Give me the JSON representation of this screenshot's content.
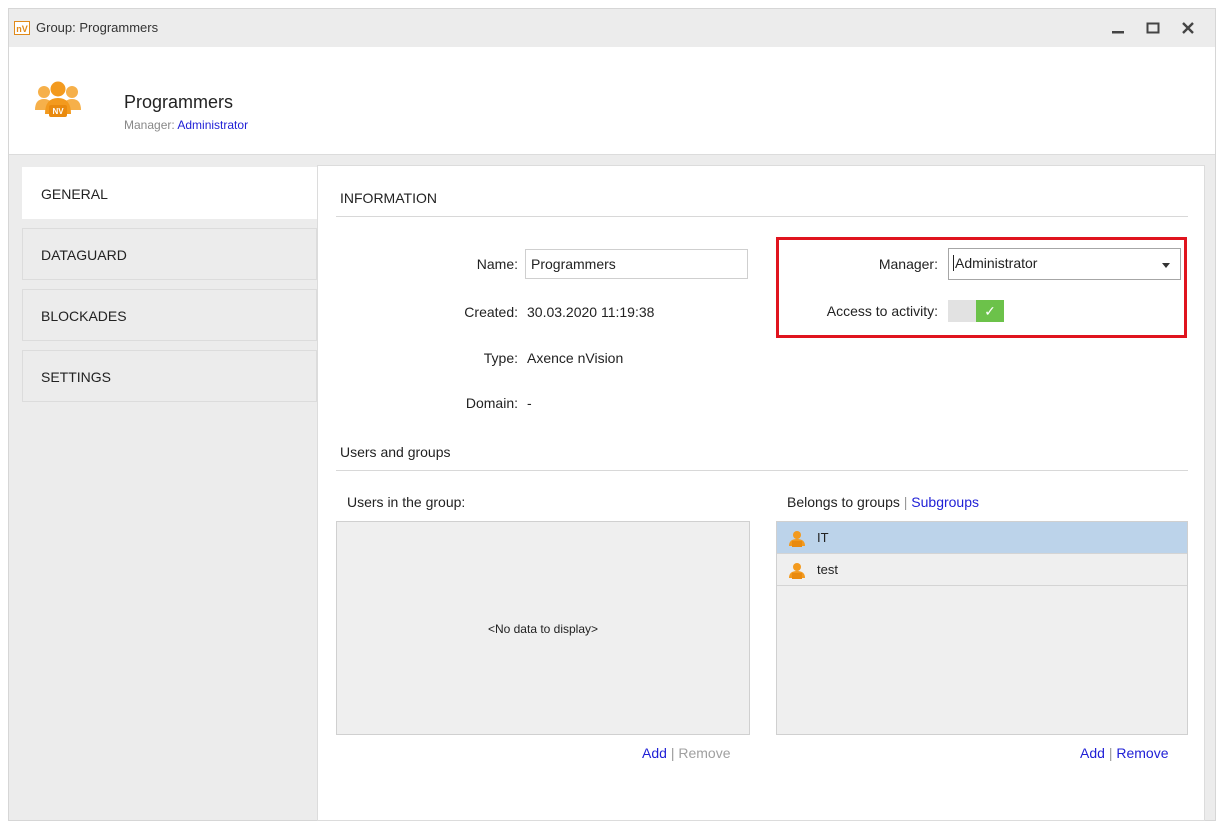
{
  "window": {
    "title": "Group: Programmers",
    "app_icon_text": "nV",
    "controls": {
      "minimize": "—",
      "maximize": "☐",
      "close": "✕"
    }
  },
  "header": {
    "group_name": "Programmers",
    "manager_label": "Manager:",
    "manager_value": "Administrator",
    "icon": "group-users-icon",
    "icon_badge": "NV"
  },
  "nav": {
    "items": [
      {
        "label": "GENERAL",
        "active": true
      },
      {
        "label": "DATAGUARD",
        "active": false
      },
      {
        "label": "BLOCKADES",
        "active": false
      },
      {
        "label": "SETTINGS",
        "active": false
      }
    ]
  },
  "information": {
    "title": "INFORMATION",
    "name_label": "Name:",
    "name_value": "Programmers",
    "created_label": "Created:",
    "created_value": "30.03.2020 11:19:38",
    "type_label": "Type:",
    "type_value": "Axence nVision",
    "domain_label": "Domain:",
    "domain_value": "-",
    "manager_label": "Manager:",
    "manager_value": "Administrator",
    "access_label": "Access to activity:",
    "access_enabled": true,
    "highlight_color": "#e0141e"
  },
  "users_groups": {
    "title": "Users and groups",
    "users_label": "Users in the group:",
    "users_empty": "<No data to display>",
    "users_add": "Add",
    "users_remove": "Remove",
    "belongs_label": "Belongs to groups",
    "separator": "|",
    "subgroups_link": "Subgroups",
    "groups": [
      {
        "label": "IT",
        "selected": true
      },
      {
        "label": "test",
        "selected": false
      }
    ],
    "groups_add": "Add",
    "groups_remove": "Remove"
  },
  "colors": {
    "link": "#1f1fd6",
    "accent_orange": "#f39a1e",
    "toggle_on": "#6cc24a",
    "selected_row": "#bcd3ea"
  }
}
